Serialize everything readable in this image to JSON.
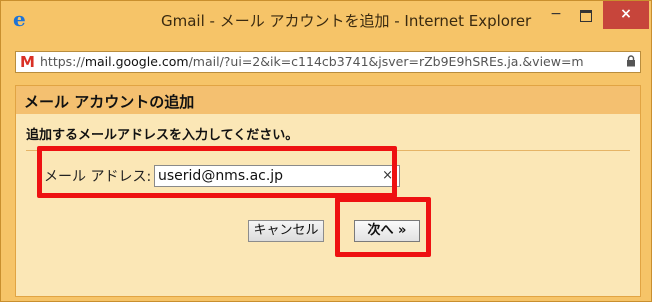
{
  "window": {
    "title": "Gmail - メール アカウントを追加 - Internet Explorer",
    "minimize_glyph": "−",
    "close_glyph": "×",
    "browser_icon": "ie-icon"
  },
  "address_bar": {
    "favicon": "gmail-m-icon",
    "scheme": "https://",
    "host": "mail.google.com",
    "path": "/mail/?ui=2&ik=c114cb3741&jsver=rZb9E9hSREs.ja.&view=m",
    "lock_icon": "lock-icon"
  },
  "dialog": {
    "title": "メール アカウントの追加",
    "instruction": "追加するメールアドレスを入力してください。",
    "email_label": "メール アドレス:",
    "email_value": "userid@nms.ac.jp",
    "clear_glyph": "×",
    "cancel_label": "キャンセル",
    "next_label": "次へ »"
  },
  "colors": {
    "frame": "#f6c468",
    "dialog_bg": "#fbe7b6",
    "dialog_header": "#f4c070",
    "highlight": "#ee1111",
    "close_button": "#c7453b"
  }
}
